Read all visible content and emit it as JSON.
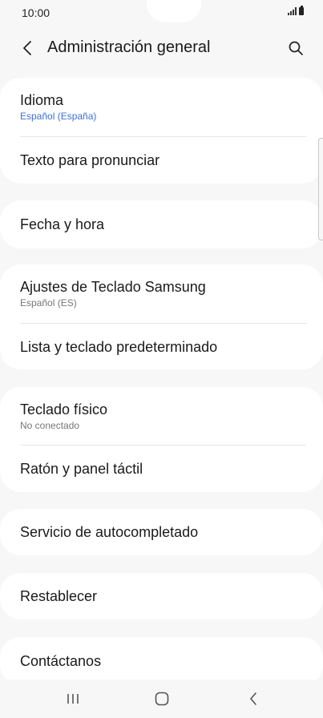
{
  "status_bar": {
    "time": "10:00"
  },
  "header": {
    "title": "Administración general"
  },
  "sections": [
    {
      "items": [
        {
          "title": "Idioma",
          "subtitle": "Español (España)"
        },
        {
          "title": "Texto para pronunciar"
        }
      ]
    },
    {
      "items": [
        {
          "title": "Fecha y hora"
        }
      ]
    },
    {
      "items": [
        {
          "title": "Ajustes de Teclado Samsung",
          "subtitle": "Español (ES)"
        },
        {
          "title": "Lista y teclado predeterminado"
        }
      ]
    },
    {
      "items": [
        {
          "title": "Teclado físico",
          "subtitle": "No conectado"
        },
        {
          "title": "Ratón y panel táctil"
        }
      ]
    },
    {
      "items": [
        {
          "title": "Servicio de autocompletado"
        }
      ]
    },
    {
      "items": [
        {
          "title": "Restablecer"
        }
      ]
    },
    {
      "items": [
        {
          "title": "Contáctanos"
        }
      ]
    }
  ],
  "colors": {
    "accent": "#3e6fd8",
    "card": "#ffffff",
    "background": "#f7f7f7"
  },
  "icons": {
    "back": "chevron-left-icon",
    "search": "search-icon",
    "nav_recents": "recents-icon",
    "nav_home": "home-icon",
    "nav_back": "back-icon"
  }
}
